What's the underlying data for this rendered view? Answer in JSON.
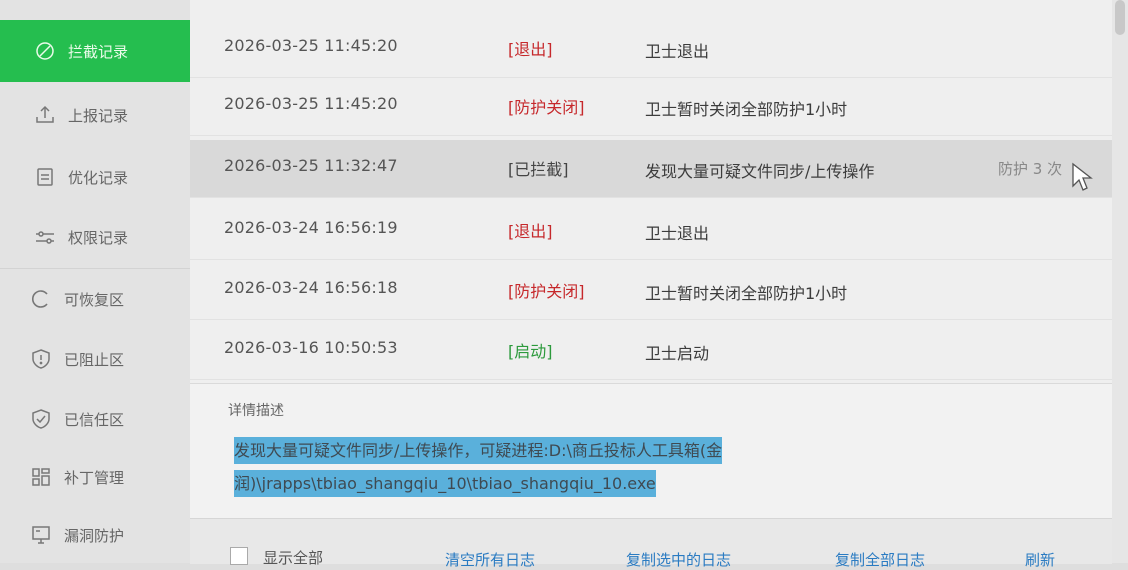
{
  "sidebar": {
    "items": [
      {
        "label": "拦截记录",
        "icon": "blocked-circle-icon"
      },
      {
        "label": "上报记录",
        "icon": "upload-icon"
      },
      {
        "label": "优化记录",
        "icon": "document-icon"
      },
      {
        "label": "权限记录",
        "icon": "sliders-icon"
      },
      {
        "label": "可恢复区",
        "icon": "refresh-icon"
      },
      {
        "label": "已阻止区",
        "icon": "shield-alert-icon"
      },
      {
        "label": "已信任区",
        "icon": "shield-check-icon"
      },
      {
        "label": "补丁管理",
        "icon": "grid-icon"
      },
      {
        "label": "漏洞防护",
        "icon": "monitor-icon"
      }
    ]
  },
  "log": {
    "rows": [
      {
        "time": "2026-03-25 11:45:20",
        "type": "[退出]",
        "desc": "卫士退出",
        "extra": ""
      },
      {
        "time": "2026-03-25 11:45:20",
        "type": "[防护关闭]",
        "desc": "卫士暂时关闭全部防护1小时",
        "extra": ""
      },
      {
        "time": "2026-03-25 11:32:47",
        "type": "[已拦截]",
        "desc": "发现大量可疑文件同步/上传操作",
        "extra": "防护 3 次"
      },
      {
        "time": "2026-03-24 16:56:19",
        "type": "[退出]",
        "desc": "卫士退出",
        "extra": ""
      },
      {
        "time": "2026-03-24 16:56:18",
        "type": "[防护关闭]",
        "desc": "卫士暂时关闭全部防护1小时",
        "extra": ""
      },
      {
        "time": "2026-03-16 10:50:53",
        "type": "[启动]",
        "desc": "卫士启动",
        "extra": ""
      }
    ]
  },
  "detail": {
    "title": "详情描述",
    "text": "发现大量可疑文件同步/上传操作，可疑进程:D:\\商丘投标人工具箱(金润)\\jrapps\\tbiao_shangqiu_10\\tbiao_shangqiu_10.exe"
  },
  "footer": {
    "show_all": "显示全部",
    "clear_all": "清空所有日志",
    "copy_selected": "复制选中的日志",
    "copy_all": "复制全部日志",
    "refresh": "刷新"
  },
  "colors": {
    "active_nav": "#25be4f",
    "red_type": "#c6282b",
    "green_type": "#2c9a3c",
    "selection": "#5ab0db",
    "link": "#2a7bc2"
  }
}
